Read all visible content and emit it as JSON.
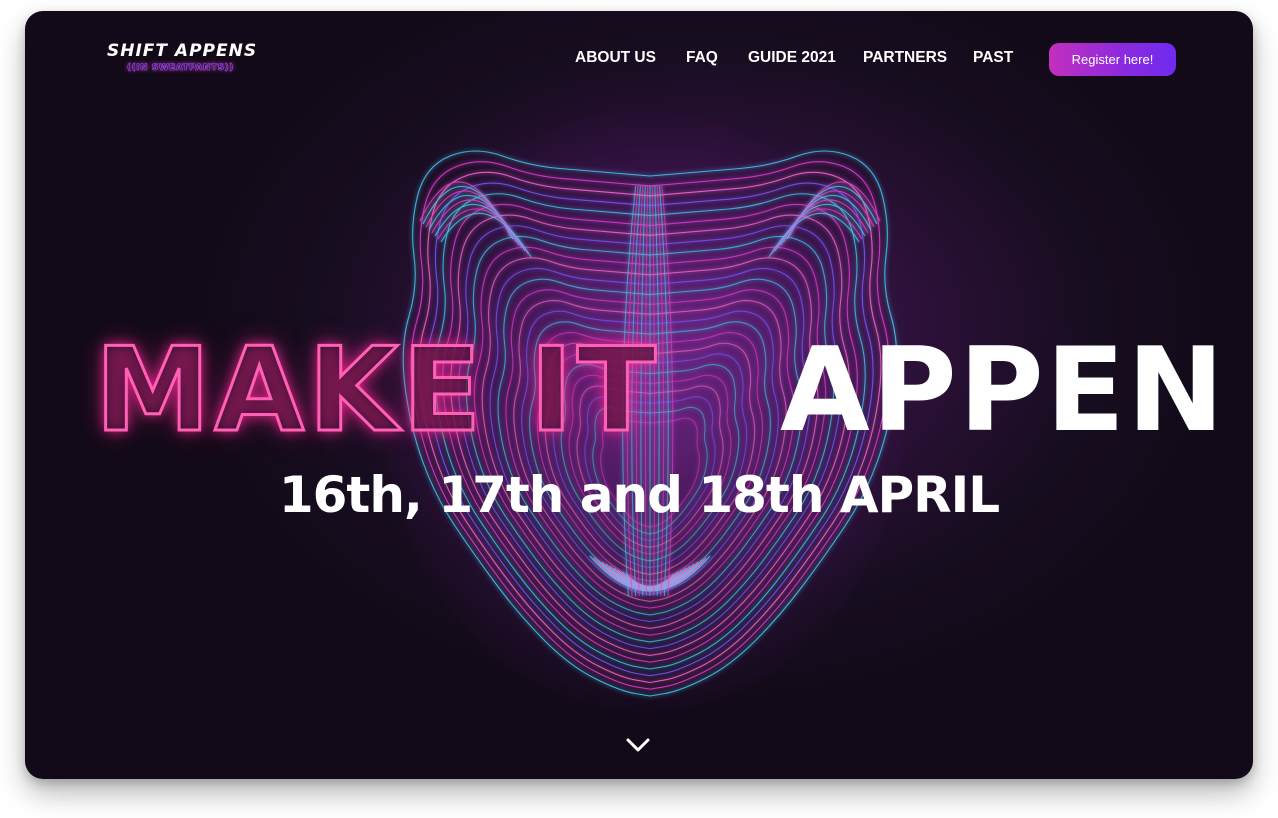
{
  "logo": {
    "main": "SHIFT APPENS",
    "sub": "((IN SWEATPANTS))"
  },
  "nav": {
    "items": [
      {
        "label": "ABOUT US"
      },
      {
        "label": "FAQ"
      },
      {
        "label": "GUIDE 2021"
      },
      {
        "label": "PARTNERS"
      },
      {
        "label": "PAST"
      }
    ],
    "register_label": "Register here!"
  },
  "hero": {
    "headline_outline": "MAKE IT",
    "headline_solid": "APPEN",
    "dates": "16th, 17th and 18th APRIL"
  },
  "icons": {
    "scroll_down": "chevron-down-icon",
    "hero_art": "neon-tiger-head"
  },
  "colors": {
    "background": "#170d20",
    "neon_pink": "#ff5fb4",
    "neon_cyan": "#45c8f0",
    "neon_magenta": "#e040d0",
    "button_gradient_start": "#c32fbd",
    "button_gradient_end": "#6e2bf0",
    "text": "#ffffff"
  }
}
